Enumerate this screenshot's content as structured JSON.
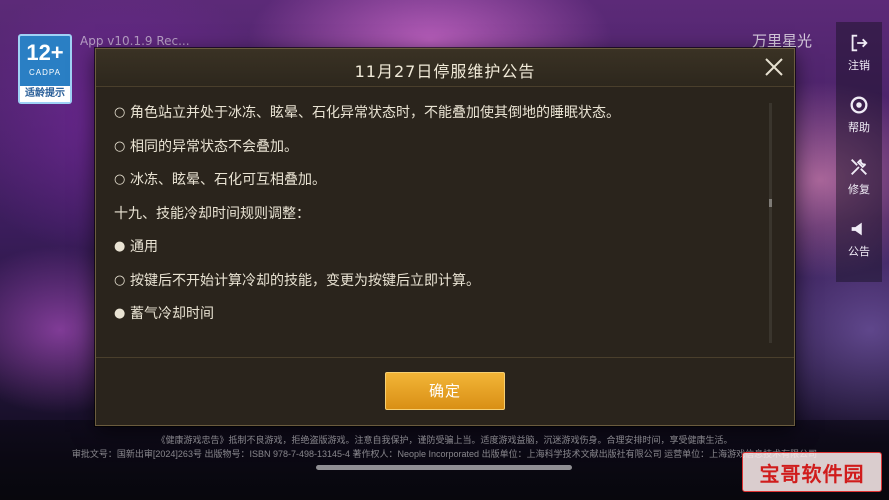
{
  "age_rating": {
    "number": "12+",
    "org": "CADPA",
    "tip": "适龄提示"
  },
  "version_text": "App v10.1.9 Rec...",
  "brand_text": "万里星光",
  "side_menu": [
    {
      "label": "注销",
      "icon": "logout-icon"
    },
    {
      "label": "帮助",
      "icon": "help-icon"
    },
    {
      "label": "修复",
      "icon": "repair-icon"
    },
    {
      "label": "公告",
      "icon": "announcement-icon"
    }
  ],
  "dialog": {
    "title": "11月27日停服维护公告",
    "lines": [
      {
        "bullet": "○",
        "text": "角色站立并处于冰冻、眩晕、石化异常状态时，不能叠加使其倒地的睡眠状态。"
      },
      {
        "bullet": "○",
        "text": "相同的异常状态不会叠加。"
      },
      {
        "bullet": "○",
        "text": "冰冻、眩晕、石化可互相叠加。"
      },
      {
        "bullet": "",
        "text": "十九、技能冷却时间规则调整："
      },
      {
        "bullet": "●",
        "text": "通用"
      },
      {
        "bullet": "○",
        "text": "按键后不开始计算冷却的技能，变更为按键后立即计算。"
      },
      {
        "bullet": "●",
        "text": "蓄气冷却时间"
      }
    ],
    "confirm_label": "确定"
  },
  "footer_notice": {
    "line1": "《健康游戏忠告》抵制不良游戏，拒绝盗版游戏。注意自我保护，谨防受骗上当。适度游戏益脑，沉迷游戏伤身。合理安排时间，享受健康生活。",
    "line2": "审批文号：国新出审[2024]263号  出版物号：ISBN 978-7-498-13145-4  著作权人：Neople Incorporated  出版单位：上海科学技术文献出版社有限公司  运营单位：上海游戏信息技术有限公司"
  },
  "watermark": "宝哥软件园"
}
